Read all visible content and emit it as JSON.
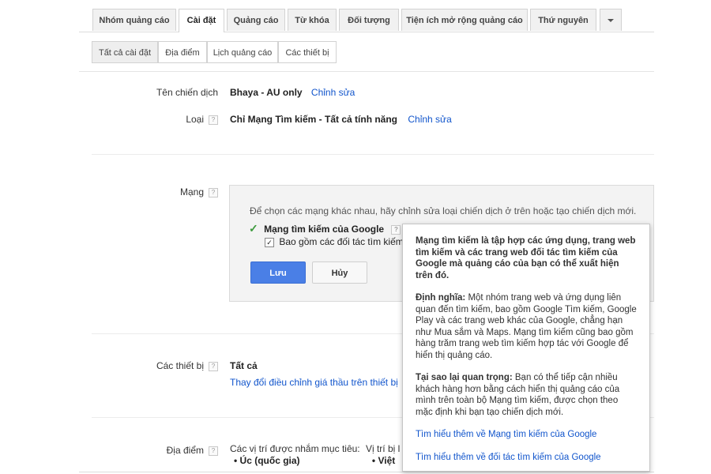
{
  "tabs": [
    {
      "label": "Nhóm quảng cáo"
    },
    {
      "label": "Cài đặt"
    },
    {
      "label": "Quảng cáo"
    },
    {
      "label": "Từ khóa"
    },
    {
      "label": "Đối tượng"
    },
    {
      "label": "Tiện ích mở rộng quảng cáo"
    },
    {
      "label": "Thứ nguyên"
    }
  ],
  "subtabs": [
    {
      "label": "Tất cả cài đặt"
    },
    {
      "label": "Địa điểm"
    },
    {
      "label": "Lịch quảng cáo"
    },
    {
      "label": "Các thiết bị"
    }
  ],
  "campaign": {
    "name_label": "Tên chiến dịch",
    "name_value": "Bhaya - AU only",
    "edit_link": "Chỉnh sửa",
    "type_label": "Loại",
    "type_value": "Chỉ Mạng Tìm kiếm - Tất cả tính năng",
    "type_edit_link": "Chỉnh sửa",
    "help_glyph": "?"
  },
  "network": {
    "label": "Mạng",
    "instruction": "Để chọn các mạng khác nhau, hãy chỉnh sửa loại chiến dịch ở trên hoặc tạo chiến dịch mới.",
    "checkmark": "✓",
    "search_network": "Mạng tìm kiếm của Google",
    "include_partners": "Bao gồm các đối tác tìm kiếm",
    "checkbox_glyph": "✓",
    "save_label": "Lưu",
    "cancel_label": "Hủy"
  },
  "devices": {
    "label": "Các thiết bị",
    "value": "Tất cả",
    "link": "Thay đổi điều chỉnh giá thầu trên thiết bị"
  },
  "location": {
    "label": "Địa điểm",
    "targeted_text": "Các vị trí được nhắm mục tiêu:",
    "cut_text": "Vị trí bị l",
    "bullet_1": "Úc (quốc gia)",
    "bullet_2": "Việt"
  },
  "tooltip": {
    "intro": "Mạng tìm kiếm là tập hợp các ứng dụng, trang web tìm kiếm và các trang web đối tác tìm kiếm của Google mà quảng cáo của bạn có thể xuất hiện trên đó.",
    "definition_title": "Định nghĩa:",
    "definition_text": "Một nhóm trang web và ứng dụng liên quan đến tìm kiếm, bao gồm Google Tìm kiếm, Google Play và các trang web khác của Google, chẳng hạn như Mua sắm và Maps. Mạng tìm kiếm cũng bao gồm hàng trăm trang web tìm kiếm hợp tác với Google để hiển thị quảng cáo.",
    "why_title": "Tại sao lại quan trọng:",
    "why_text": "Bạn có thể tiếp cận nhiều khách hàng hơn bằng cách hiển thị quảng cáo của mình trên toàn bộ Mạng tìm kiếm, được chọn theo mặc định khi bạn tạo chiến dịch mới.",
    "link_1": "Tìm hiểu thêm về Mạng tìm kiếm của Google",
    "link_2": "Tìm hiểu thêm về đối tác tìm kiếm của Google"
  }
}
